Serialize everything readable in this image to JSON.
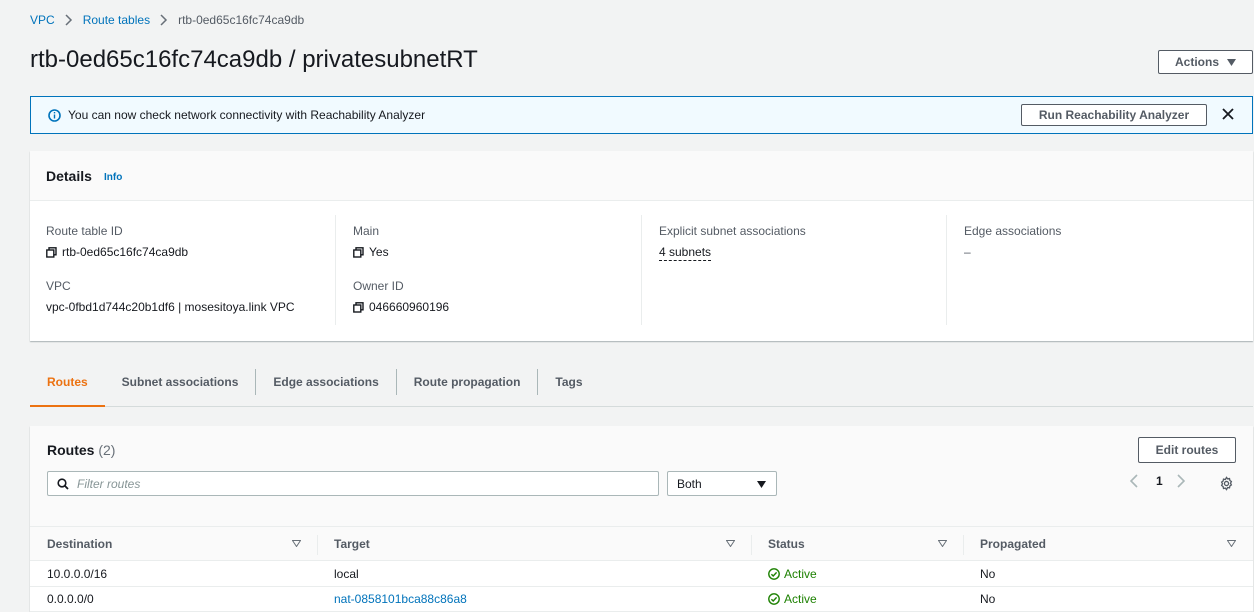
{
  "breadcrumb": {
    "items": [
      "VPC",
      "Route tables"
    ],
    "current": "rtb-0ed65c16fc74ca9db"
  },
  "page_title": "rtb-0ed65c16fc74ca9db / privatesubnetRT",
  "actions_label": "Actions",
  "banner": {
    "text": "You can now check network connectivity with Reachability Analyzer",
    "button": "Run Reachability Analyzer"
  },
  "details": {
    "title": "Details",
    "info": "Info",
    "route_table_id_label": "Route table ID",
    "route_table_id": "rtb-0ed65c16fc74ca9db",
    "vpc_label": "VPC",
    "vpc_value": "vpc-0fbd1d744c20b1df6 | mosesitoya.link VPC",
    "main_label": "Main",
    "main_value": "Yes",
    "owner_label": "Owner ID",
    "owner_value": "046660960196",
    "explicit_label": "Explicit subnet associations",
    "explicit_value": "4 subnets",
    "edge_label": "Edge associations",
    "edge_value": "–"
  },
  "tabs": [
    "Routes",
    "Subnet associations",
    "Edge associations",
    "Route propagation",
    "Tags"
  ],
  "routes": {
    "title": "Routes",
    "count": "(2)",
    "edit_label": "Edit routes",
    "filter_placeholder": "Filter routes",
    "select_value": "Both",
    "page": "1",
    "columns": [
      "Destination",
      "Target",
      "Status",
      "Propagated"
    ],
    "rows": [
      {
        "destination": "10.0.0.0/16",
        "target": "local",
        "status": "Active",
        "propagated": "No"
      },
      {
        "destination": "0.0.0.0/0",
        "target": "nat-0858101bca88c86a8",
        "status": "Active",
        "propagated": "No"
      }
    ]
  },
  "colors": {
    "link": "#0073bb",
    "active_tab": "#ec7211",
    "success": "#1d8102",
    "banner_bg": "#f1faff"
  }
}
